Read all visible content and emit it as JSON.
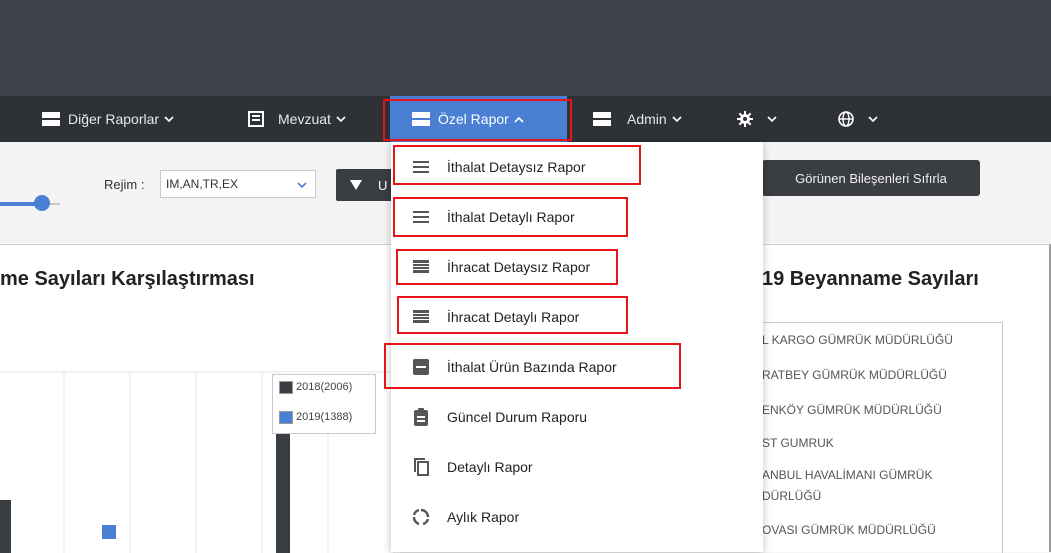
{
  "navbar": {
    "items": [
      {
        "label": "Diğer Raporlar",
        "icon": "table-rows-icon"
      },
      {
        "label": "Mevzuat",
        "icon": "book-icon"
      },
      {
        "label": "Özel Rapor",
        "icon": "table-rows-icon",
        "active": true
      },
      {
        "label": "Admin",
        "icon": "table-rows-icon"
      },
      {
        "label": "",
        "icon": "gear-icon"
      },
      {
        "label": "",
        "icon": "globe-icon"
      }
    ]
  },
  "filters": {
    "regime_label": "Rejim :",
    "regime_value": "IM,AN,TR,EX",
    "filter_button_label": "U",
    "reset_button_label": "Görünen Bileşenleri Sıfırla"
  },
  "left_card": {
    "title": "me Sayıları Karşılaştırması",
    "legend": [
      {
        "label": "2018(2006)",
        "color": "#3a3d42"
      },
      {
        "label": "2019(1388)",
        "color": "#4a7fd4"
      }
    ]
  },
  "right_card": {
    "title": "19 Beyanname Sayıları",
    "list": [
      "L KARGO GÜMRÜK MÜDÜRLÜĞÜ",
      "RATBEY GÜMRÜK MÜDÜRLÜĞÜ",
      "ENKÖY GÜMRÜK MÜDÜRLÜĞÜ",
      "ST GUMRUK",
      "ANBUL HAVALİMANI GÜMRÜK",
      "DÜRLÜĞÜ",
      "OVASI GÜMRÜK MÜDÜRLÜĞÜ"
    ]
  },
  "dropdown": {
    "items": [
      {
        "label": "İthalat Detaysız Rapor",
        "icon": "menu-lines-icon"
      },
      {
        "label": "İthalat Detaylı Rapor",
        "icon": "menu-lines-icon"
      },
      {
        "label": "İhracat Detaysız Rapor",
        "icon": "list-icon"
      },
      {
        "label": "İhracat Detaylı Rapor",
        "icon": "list-icon"
      },
      {
        "label": "İthalat Ürün Bazında Rapor",
        "icon": "card-icon"
      },
      {
        "label": "Güncel Durum Raporu",
        "icon": "clipboard-icon"
      },
      {
        "label": "Detaylı Rapor",
        "icon": "copy-icon"
      },
      {
        "label": "Aylık Rapor",
        "icon": "circle-loading-icon"
      }
    ]
  },
  "colors": {
    "accent": "#4a7fd4",
    "highlight": "#e8141b",
    "navbar": "#2e3136",
    "topbar": "#3e4147"
  }
}
